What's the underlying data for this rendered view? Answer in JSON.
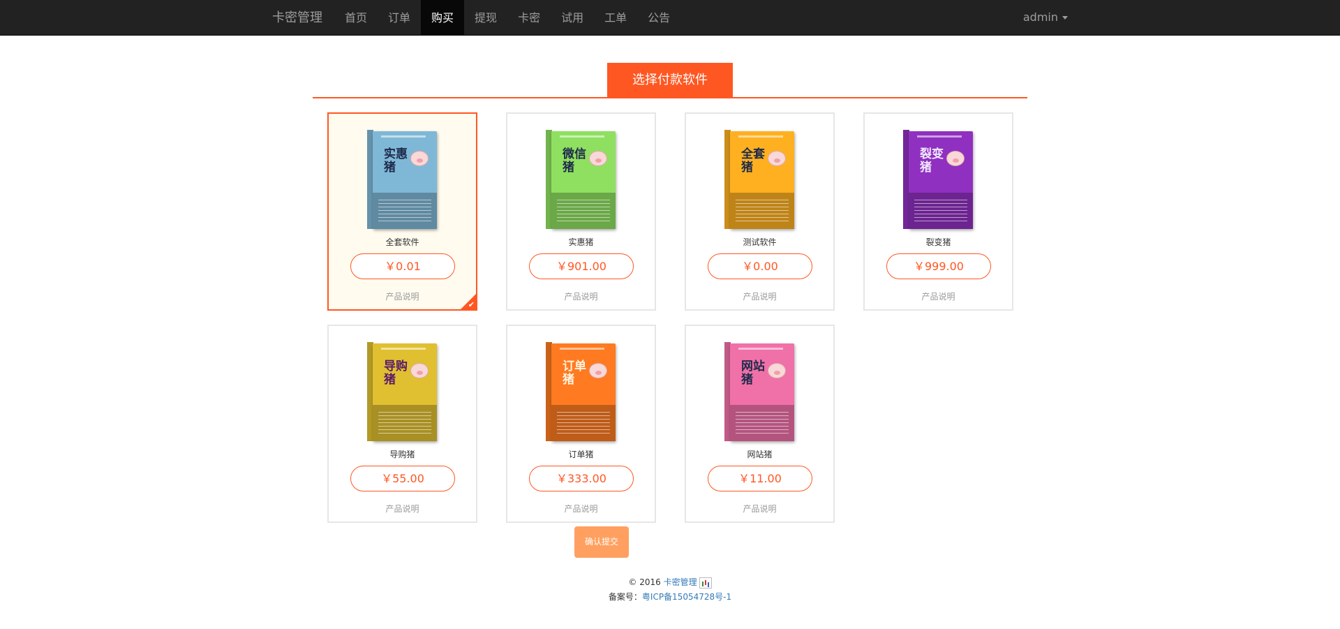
{
  "navbar": {
    "brand": "卡密管理",
    "items": [
      {
        "label": "首页",
        "active": false
      },
      {
        "label": "订单",
        "active": false
      },
      {
        "label": "购买",
        "active": true
      },
      {
        "label": "提现",
        "active": false
      },
      {
        "label": "卡密",
        "active": false
      },
      {
        "label": "试用",
        "active": false
      },
      {
        "label": "工单",
        "active": false
      },
      {
        "label": "公告",
        "active": false
      }
    ],
    "user": "admin"
  },
  "section_title": "选择付款软件",
  "products": [
    {
      "name": "全套软件",
      "price": "￥0.01",
      "desc": "产品说明",
      "box_title": "实惠猪",
      "color": "#7fb8d6",
      "selected": true
    },
    {
      "name": "实惠猪",
      "price": "￥901.00",
      "desc": "产品说明",
      "box_title": "微信猪",
      "color": "#8fe060",
      "selected": false
    },
    {
      "name": "测试软件",
      "price": "￥0.00",
      "desc": "产品说明",
      "box_title": "全套猪",
      "color": "#ffb020",
      "selected": false
    },
    {
      "name": "裂变猪",
      "price": "￥999.00",
      "desc": "产品说明",
      "box_title": "裂变猪",
      "color": "#9030c0",
      "selected": false
    },
    {
      "name": "导购猪",
      "price": "￥55.00",
      "desc": "产品说明",
      "box_title": "导购猪",
      "color": "#e0c030",
      "selected": false
    },
    {
      "name": "订单猪",
      "price": "￥333.00",
      "desc": "产品说明",
      "box_title": "订单猪",
      "color": "#ff7a20",
      "selected": false
    },
    {
      "name": "网站猪",
      "price": "￥11.00",
      "desc": "产品说明",
      "box_title": "网站猪",
      "color": "#f070a8",
      "selected": false
    }
  ],
  "submit_label": "确认提交",
  "footer": {
    "copyright_prefix": "© 2016",
    "brand_link": "卡密管理",
    "icp_label": "备案号：",
    "icp_link": "粤ICP备15054728号-1"
  }
}
